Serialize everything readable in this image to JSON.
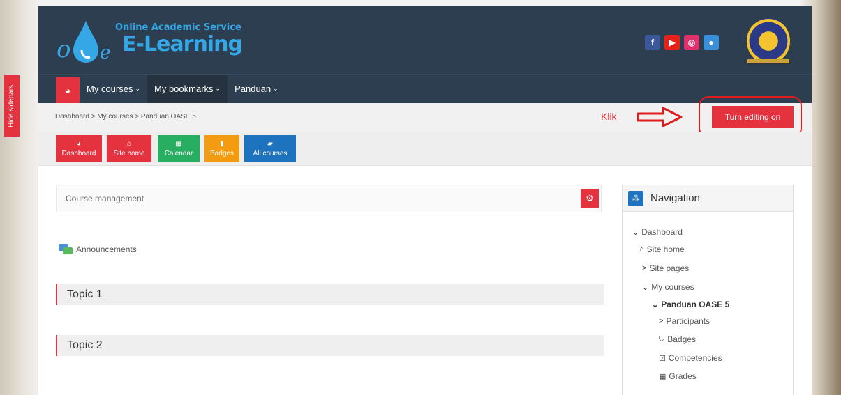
{
  "sidebar_toggle": {
    "label": "Hide sidebars"
  },
  "header": {
    "logo_subtitle": "Online Academic Service",
    "logo_title": "E-Learning",
    "social": [
      {
        "name": "facebook",
        "glyph": "f",
        "color": "#3b5998"
      },
      {
        "name": "youtube",
        "glyph": "▶",
        "color": "#e62117"
      },
      {
        "name": "instagram",
        "glyph": "◎",
        "color": "#e1306c"
      },
      {
        "name": "website",
        "glyph": "●",
        "color": "#3b8fd6"
      }
    ]
  },
  "navbar": {
    "items": [
      {
        "label": "My courses"
      },
      {
        "label": "My bookmarks"
      },
      {
        "label": "Panduan"
      }
    ]
  },
  "breadcrumb": {
    "items": [
      "Dashboard",
      "My courses",
      "Panduan OASE 5"
    ],
    "separator": ">"
  },
  "annotation": {
    "klik": "Klik"
  },
  "actions": {
    "turn_editing": "Turn editing on"
  },
  "quick_links": [
    {
      "label": "Dashboard",
      "icon": "dashboard-icon",
      "color": "#e5323f"
    },
    {
      "label": "Site home",
      "icon": "home-icon",
      "color": "#e5323f"
    },
    {
      "label": "Calendar",
      "icon": "calendar-icon",
      "color": "#27ae60"
    },
    {
      "label": "Badges",
      "icon": "bookmark-icon",
      "color": "#f39c12"
    },
    {
      "label": "All courses",
      "icon": "book-icon",
      "color": "#1e73be"
    }
  ],
  "main": {
    "course_management": "Course management",
    "announcements": "Announcements",
    "topics": [
      "Topic 1",
      "Topic 2"
    ]
  },
  "navigation": {
    "title": "Navigation",
    "tree": [
      {
        "label": "Dashboard",
        "prefix": "⌄"
      },
      {
        "label": "Site home",
        "prefix": "🏠"
      },
      {
        "label": "Site pages",
        "prefix": ">"
      },
      {
        "label": "My courses",
        "prefix": "⌄"
      },
      {
        "label": "Panduan OASE 5",
        "prefix": "⌄"
      },
      {
        "label": "Participants",
        "prefix": ">"
      },
      {
        "label": "Badges",
        "prefix": "⛉"
      },
      {
        "label": "Competencies",
        "prefix": "☑"
      },
      {
        "label": "Grades",
        "prefix": "▦"
      }
    ]
  }
}
